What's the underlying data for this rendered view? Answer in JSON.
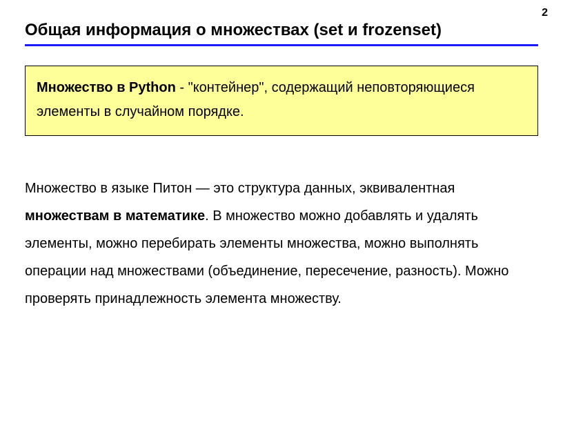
{
  "page_number": "2",
  "title": "Общая информация о множествах (set и frozenset)",
  "definition": {
    "bold": "Множество в Python",
    "rest": " - \"контейнер\", содержащий неповторяющиеся элементы в случайном порядке."
  },
  "body": {
    "part1": "Множество в языке Питон — это структура данных, эквивалентная ",
    "bold": "множествам в математике",
    "part2": ". В множество можно добавлять и удалять элементы, можно перебирать элементы множества, можно выполнять операции над множествами (объединение, пересечение, разность). Можно проверять принадлежность элемента множеству."
  }
}
